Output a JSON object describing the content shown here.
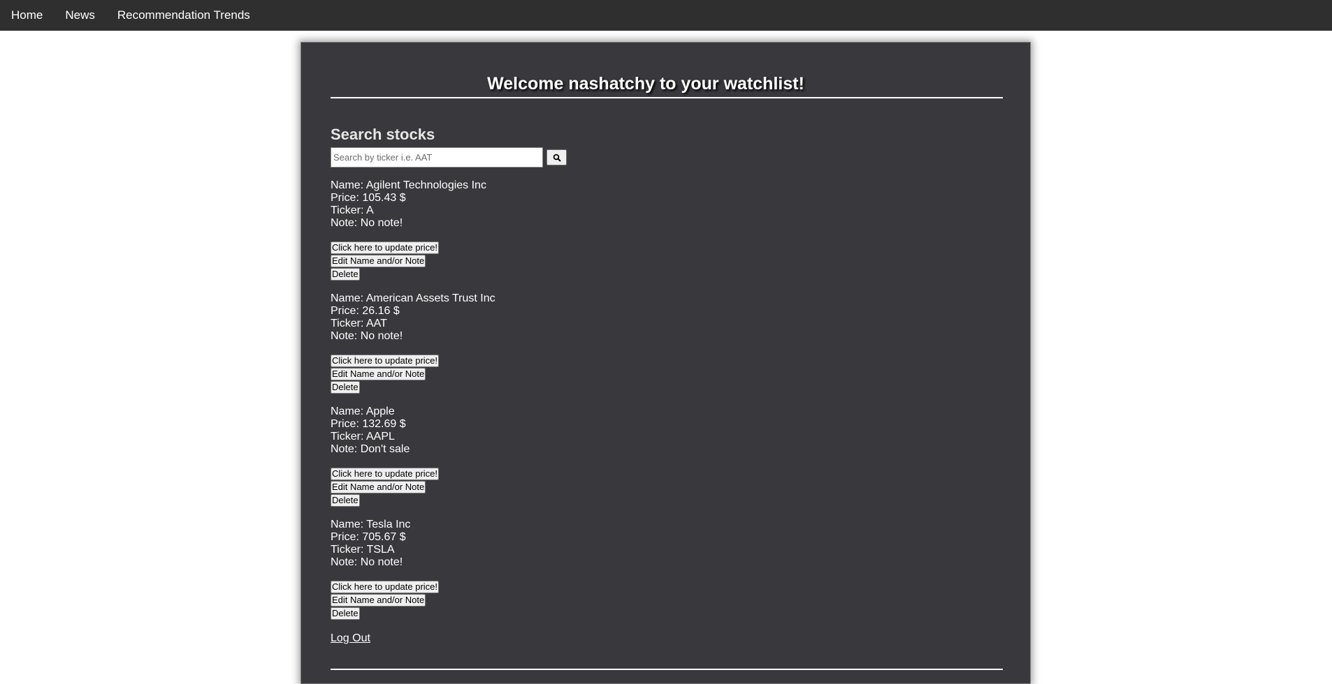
{
  "nav": {
    "items": [
      {
        "label": "Home"
      },
      {
        "label": "News"
      },
      {
        "label": "Recommendation Trends"
      }
    ]
  },
  "page": {
    "title": "Welcome nashatchy to your watchlist!"
  },
  "search": {
    "heading": "Search stocks",
    "placeholder": "Search by ticker i.e. AAT",
    "button_icon": "search-icon"
  },
  "buttons": {
    "update_label": "Click here to update price!",
    "edit_label": "Edit Name and/or Note",
    "delete_label": "Delete"
  },
  "stocks": [
    {
      "name": "Name: Agilent Technologies Inc",
      "price": "Price: 105.43 $",
      "ticker": "Ticker: A",
      "note": "Note: No note!"
    },
    {
      "name": "Name: American Assets Trust Inc",
      "price": "Price: 26.16 $",
      "ticker": "Ticker: AAT",
      "note": "Note: No note!"
    },
    {
      "name": "Name: Apple",
      "price": "Price: 132.69 $",
      "ticker": "Ticker: AAPL",
      "note": "Note: Don't sale"
    },
    {
      "name": "Name: Tesla Inc",
      "price": "Price: 705.67 $",
      "ticker": "Ticker: TSLA",
      "note": "Note: No note!"
    }
  ],
  "logout": {
    "label": "Log Out"
  },
  "colors": {
    "navbar": "#2f2f2f",
    "panel": "#39393d",
    "text": "#ffffff"
  }
}
